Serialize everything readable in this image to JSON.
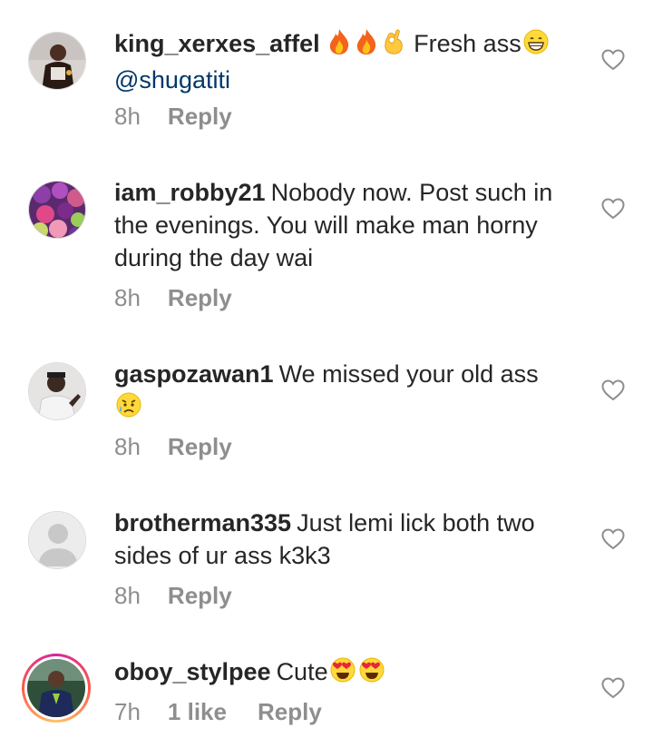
{
  "comments": [
    {
      "username": "king_xerxes_affel",
      "text": "Fresh ass",
      "mention": "@shugatiti",
      "time": "8h",
      "reply_label": "Reply",
      "emojis_before_text": [
        "fire-emoji",
        "fire-emoji",
        "ok-hand-emoji"
      ],
      "emojis_after_text": [
        "grinning-face-emoji"
      ]
    },
    {
      "username": "iam_robby21",
      "text_line1": "Nobody now. Post such in",
      "text_line2": "the evenings. You will make man horny",
      "text_line3": "during the day wai",
      "time": "8h",
      "reply_label": "Reply"
    },
    {
      "username": "gaspozawan1",
      "text": "We missed your old ass",
      "time": "8h",
      "reply_label": "Reply",
      "emojis_after_text": [
        "sad-but-relieved-face-emoji"
      ]
    },
    {
      "username": "brotherman335",
      "text_line1": "Just lemi lick both two",
      "text_line2": "sides of ur ass k3k3",
      "time": "8h",
      "reply_label": "Reply"
    },
    {
      "username": "oboy_stylpee",
      "text": "Cute",
      "time": "7h",
      "likes": "1 like",
      "reply_label": "Reply",
      "emojis_after_text": [
        "heart-eyes-emoji",
        "heart-eyes-emoji"
      ]
    }
  ],
  "colors": {
    "text": "#262626",
    "meta": "#8e8e8e",
    "mention": "#00376b",
    "heart_outline": "#8e8e8e"
  }
}
